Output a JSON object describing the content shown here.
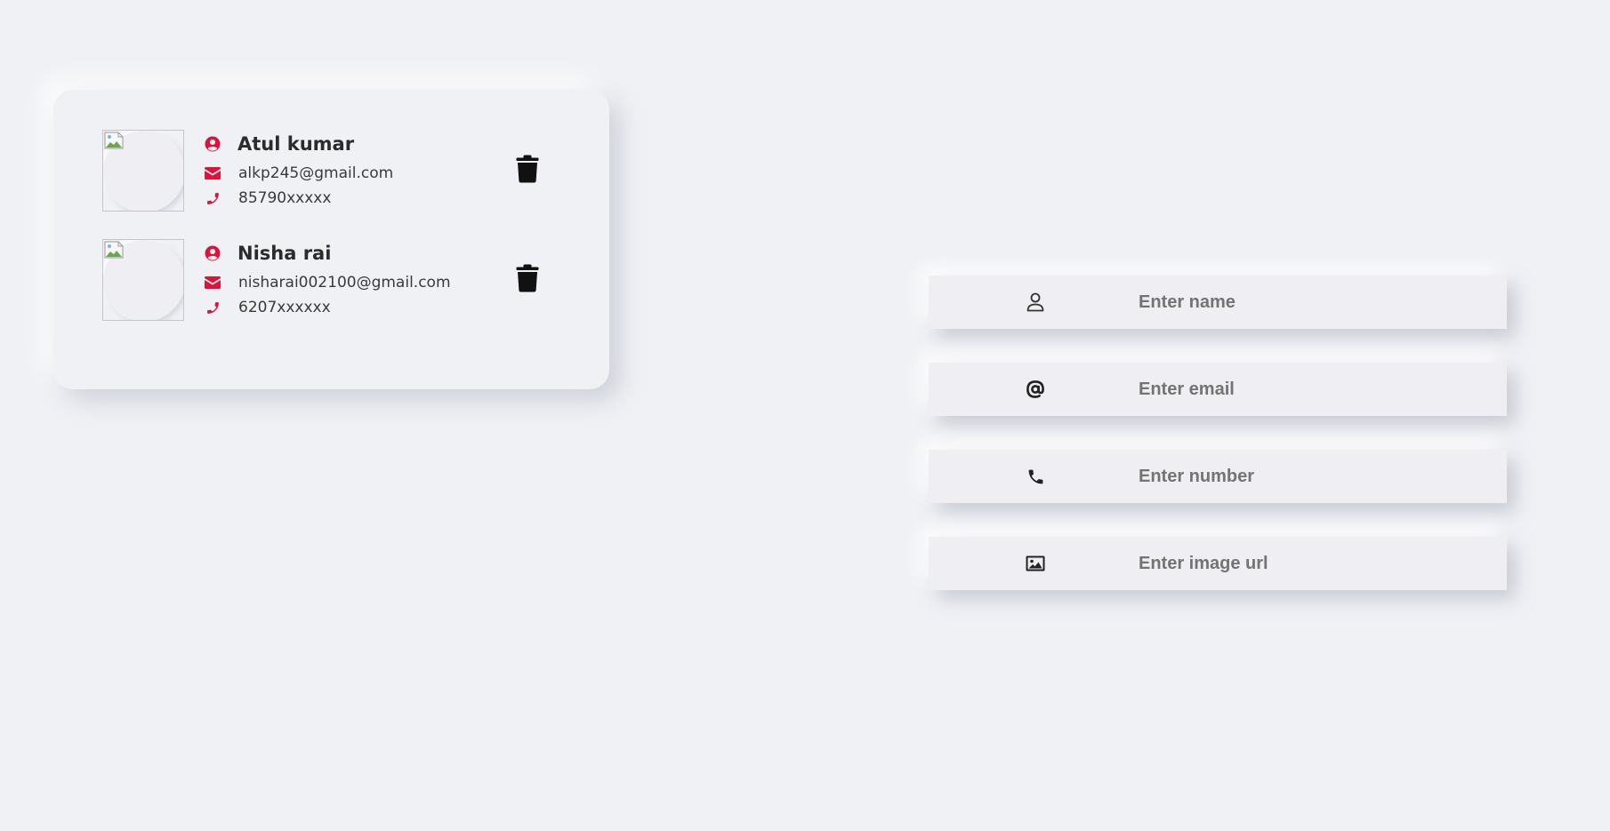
{
  "colors": {
    "background": "#f0f1f5",
    "accent": "#dc143c",
    "icon_dark": "#111111"
  },
  "contacts": [
    {
      "name": "Atul kumar",
      "email": "alkp245@gmail.com",
      "phone": "85790xxxxx",
      "avatar_icon": "broken-image-icon",
      "name_icon": "user-circle-icon",
      "email_icon": "envelope-icon",
      "phone_icon": "phone-icon",
      "delete_icon": "trash-icon"
    },
    {
      "name": "Nisha rai",
      "email": "nisharai002100@gmail.com",
      "phone": "6207xxxxxx",
      "avatar_icon": "broken-image-icon",
      "name_icon": "user-circle-icon",
      "email_icon": "envelope-icon",
      "phone_icon": "phone-icon",
      "delete_icon": "trash-icon"
    }
  ],
  "form": {
    "name": {
      "placeholder": "Enter name",
      "value": "",
      "icon": "user-outline-icon"
    },
    "email": {
      "placeholder": "Enter email",
      "value": "",
      "icon": "at-sign-icon"
    },
    "number": {
      "placeholder": "Enter number",
      "value": "",
      "icon": "phone-icon"
    },
    "image_url": {
      "placeholder": "Enter image url",
      "value": "",
      "icon": "image-icon"
    }
  }
}
